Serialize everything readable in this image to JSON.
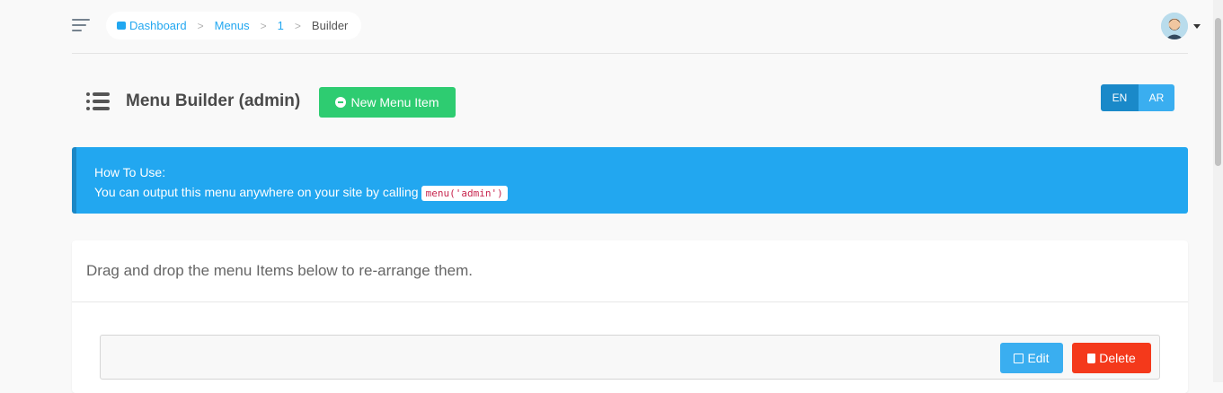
{
  "breadcrumb": {
    "items": [
      {
        "label": "Dashboard",
        "icon": "dashboard-icon"
      },
      {
        "label": "Menus"
      },
      {
        "label": "1"
      },
      {
        "label": "Builder"
      }
    ]
  },
  "header": {
    "title": "Menu Builder (admin)",
    "new_item_label": "New Menu Item"
  },
  "languages": [
    "EN",
    "AR"
  ],
  "alert": {
    "heading": "How To Use:",
    "text": "You can output this menu anywhere on your site by calling",
    "code": "menu('admin')"
  },
  "panel": {
    "heading": "Drag and drop the menu Items below to re-arrange them.",
    "item_actions": {
      "edit": "Edit",
      "delete": "Delete"
    }
  },
  "colors": {
    "accent": "#22a7f0",
    "success": "#2ecc71",
    "danger": "#f4391b"
  }
}
